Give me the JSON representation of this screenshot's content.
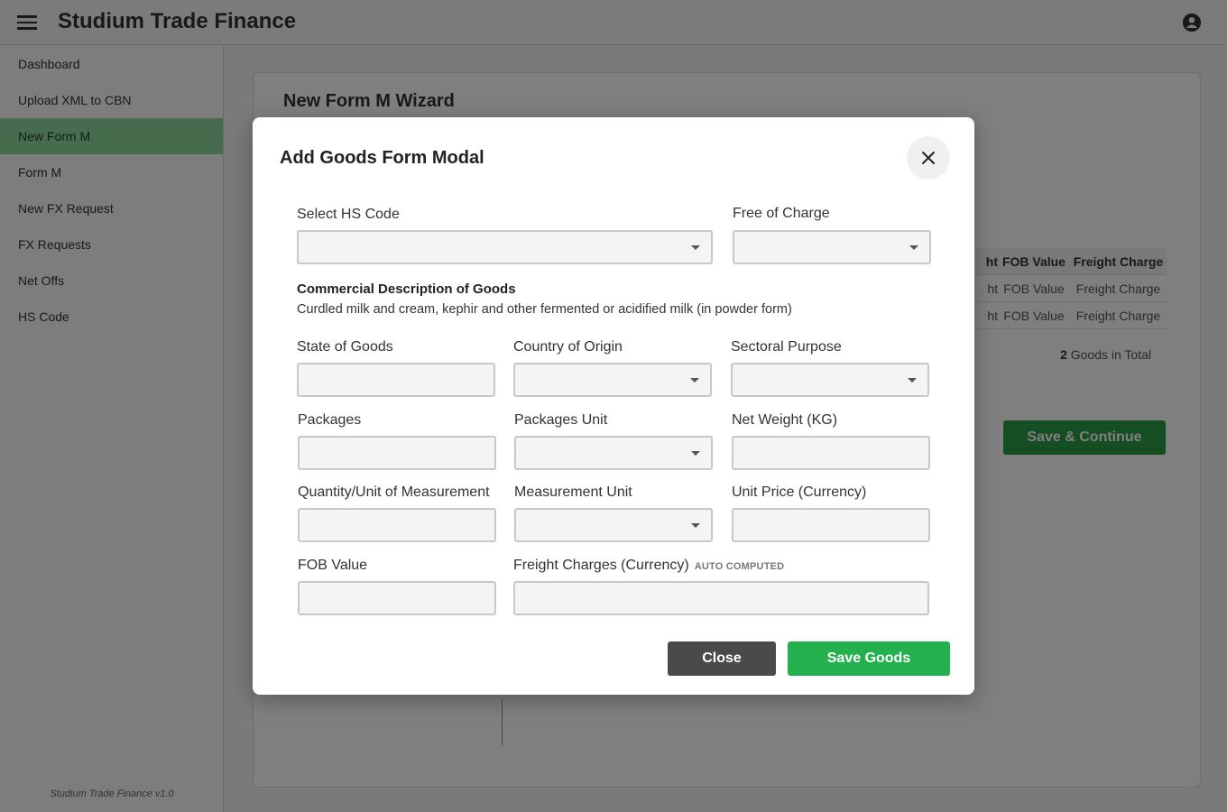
{
  "app": {
    "title": "Studium Trade Finance",
    "version": "Studium Trade Finance v1.0"
  },
  "sidebar": {
    "items": [
      {
        "label": "Dashboard",
        "active": false
      },
      {
        "label": "Upload XML to CBN",
        "active": false
      },
      {
        "label": "New Form M",
        "active": true
      },
      {
        "label": "Form M",
        "active": false
      },
      {
        "label": "New FX Request",
        "active": false
      },
      {
        "label": "FX Requests",
        "active": false
      },
      {
        "label": "Net Offs",
        "active": false
      },
      {
        "label": "HS Code",
        "active": false
      }
    ]
  },
  "wizard": {
    "title": "New Form M Wizard",
    "table": {
      "headers": [
        "ht",
        "FOB Value",
        "Freight Charge"
      ],
      "rows": [
        [
          "ht",
          "FOB Value",
          "Freight Charge"
        ],
        [
          "ht",
          "FOB Value",
          "Freight Charge"
        ]
      ]
    },
    "total_count": "2",
    "total_label": " Goods in Total",
    "save_continue": "Save & Continue"
  },
  "modal": {
    "title": "Add Goods Form Modal",
    "fields": {
      "hs_code": {
        "label": "Select HS Code",
        "value": ""
      },
      "free_of_charge": {
        "label": "Free of Charge",
        "value": ""
      },
      "state_of_goods": {
        "label": "State of Goods",
        "value": ""
      },
      "country_of_origin": {
        "label": "Country of Origin",
        "value": ""
      },
      "sectoral_purpose": {
        "label": "Sectoral Purpose",
        "value": ""
      },
      "packages": {
        "label": "Packages",
        "value": ""
      },
      "packages_unit": {
        "label": "Packages Unit",
        "value": ""
      },
      "net_weight": {
        "label": "Net Weight (KG)",
        "value": ""
      },
      "quantity": {
        "label": "Quantity/Unit of Measurement",
        "value": ""
      },
      "measurement_unit": {
        "label": "Measurement Unit",
        "value": ""
      },
      "unit_price": {
        "label": "Unit Price (Currency)",
        "value": ""
      },
      "fob_value": {
        "label": "FOB Value",
        "value": ""
      },
      "freight_charges": {
        "label": "Freight Charges (Currency)",
        "tag": "AUTO COMPUTED",
        "value": ""
      }
    },
    "description": {
      "heading": "Commercial Description of Goods",
      "text": "Curdled milk and cream, kephir and other fermented or acidified milk (in powder form)"
    },
    "buttons": {
      "close": "Close",
      "save": "Save Goods"
    }
  },
  "colors": {
    "accent_green": "#24b04c",
    "sidebar_active": "#8cd99b",
    "close_button": "#4a4a4a"
  },
  "icons": [
    "menu-icon",
    "account-circle-icon",
    "close-icon",
    "chevron-down-icon"
  ]
}
